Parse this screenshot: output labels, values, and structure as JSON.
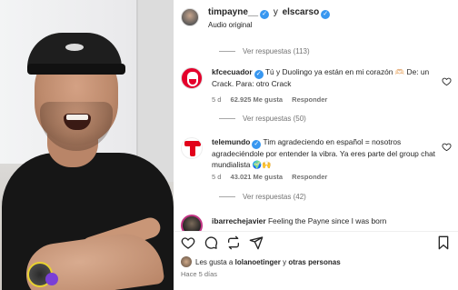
{
  "header": {
    "user1": "timpayne__",
    "connector": "y",
    "user2": "elscarso",
    "subtitle": "Audio original"
  },
  "replies": [
    {
      "label": "Ver respuestas (113)"
    },
    {
      "label": "Ver respuestas (50)"
    },
    {
      "label": "Ver respuestas (42)"
    }
  ],
  "comments": [
    {
      "user": "kfcecuador",
      "text": "Tú y Duolingo ya están en mi corazón 🫶🏻 De: un Crack. Para: otro Crack",
      "age": "5 d",
      "likes": "62.925 Me gusta",
      "reply": "Responder"
    },
    {
      "user": "telemundo",
      "text": "Tim agradeciendo en español = nosotros agradeciéndole por entender la vibra. Ya eres parte del group chat mundialista 🌍🙌",
      "age": "5 d",
      "likes": "43.021 Me gusta",
      "reply": "Responder"
    },
    {
      "user": "ibarrechejavier",
      "text": "Feeling the Payne since I was born"
    }
  ],
  "footer": {
    "likes_prefix": "Les gusta a",
    "likes_user": "lolanoetinger",
    "likes_mid": "y",
    "likes_others": "otras personas",
    "time": "Hace 5 días"
  },
  "icons": {
    "like": "heart-icon",
    "comment": "comment-icon",
    "repost": "repost-icon",
    "share": "share-icon",
    "save": "bookmark-icon"
  },
  "colors": {
    "verified": "#3897f0",
    "muted": "#737373",
    "text": "#262626"
  }
}
